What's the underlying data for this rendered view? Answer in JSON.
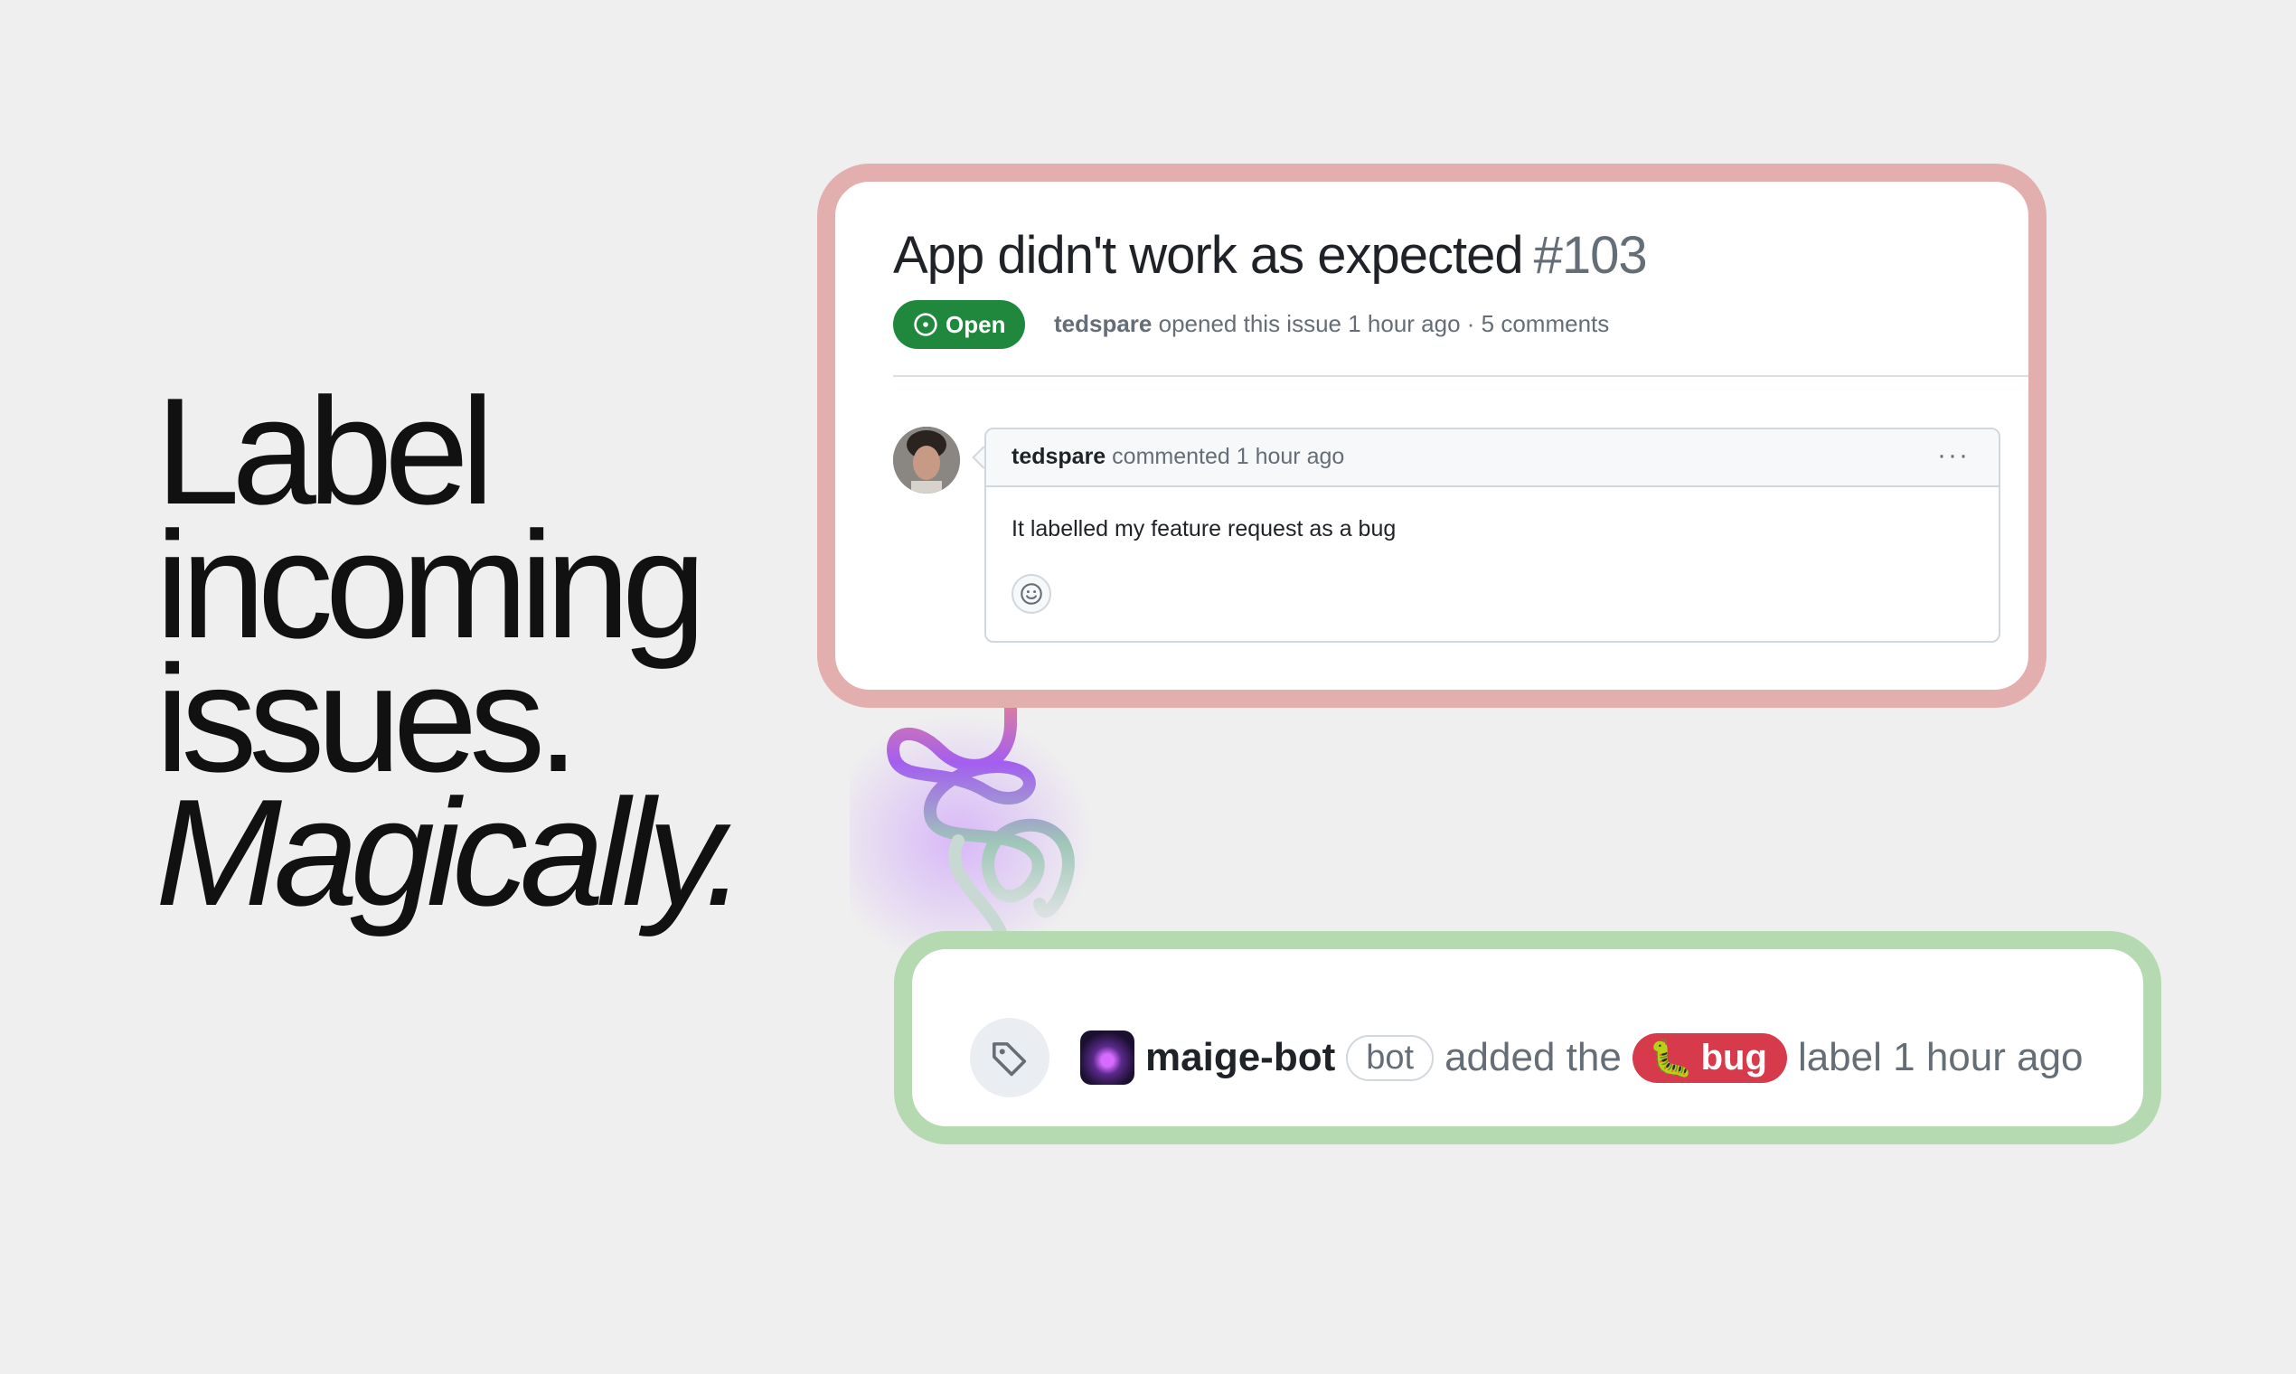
{
  "headline": {
    "line1": "Label",
    "line2": "incoming",
    "line3": "issues.",
    "line4": "Magically."
  },
  "issue": {
    "title": "App didn't work as expected",
    "number": "#103",
    "status": "Open",
    "author": "tedspare",
    "meta_text": "opened this issue 1 hour ago · 5 comments"
  },
  "comment": {
    "author": "tedspare",
    "action": "commented 1 hour ago",
    "more": "···",
    "body": "It labelled my feature request as a bug"
  },
  "event": {
    "actor": "maige-bot",
    "badge": "bot",
    "pre_text": "added the",
    "label_name": "bug",
    "label_emoji": "🐛",
    "post_text": "label 1 hour ago"
  },
  "colors": {
    "issue_frame": "#e3aeae",
    "event_frame": "#b5d9b0",
    "open_green": "#1f883d",
    "bug_red": "#d73a4a"
  },
  "icons": [
    "issue-opened-icon",
    "smiley-icon",
    "tag-icon",
    "kebab-icon"
  ]
}
